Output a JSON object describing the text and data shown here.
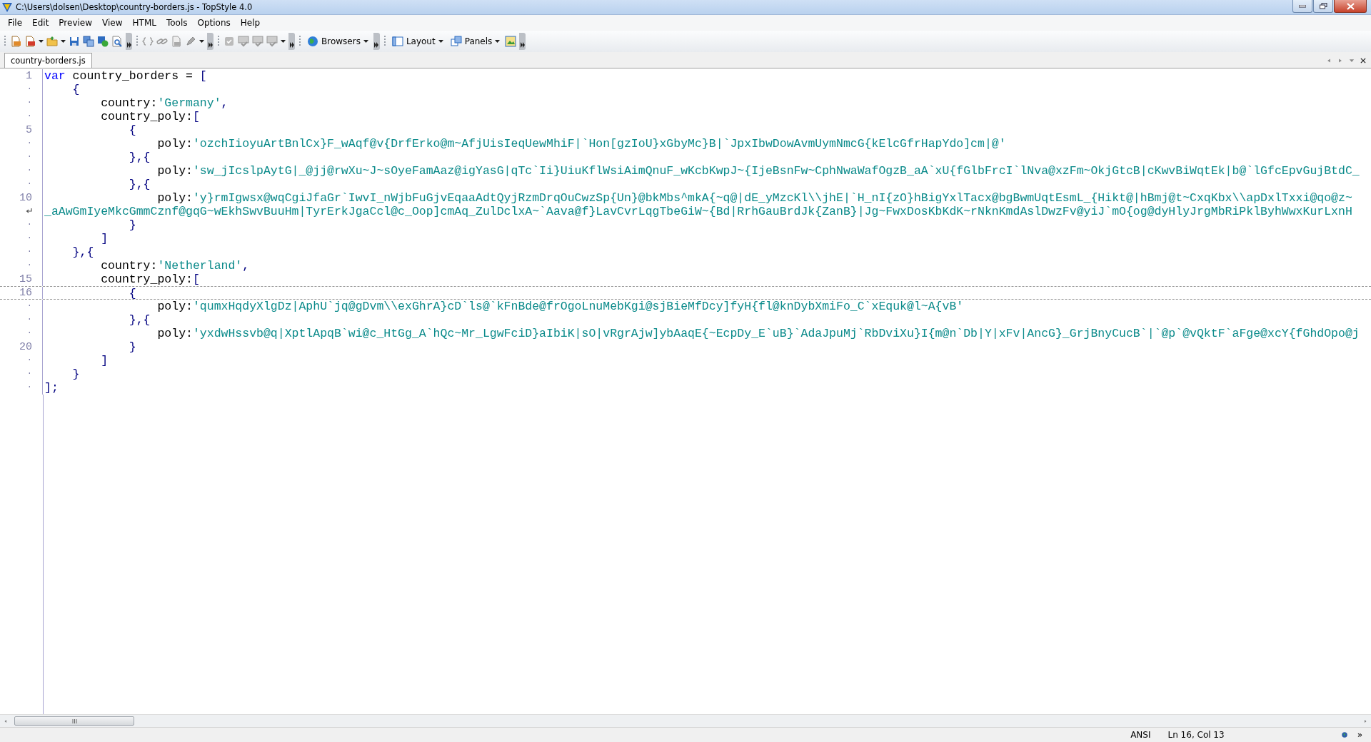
{
  "window": {
    "title": "C:\\Users\\dolsen\\Desktop\\country-borders.js - TopStyle 4.0"
  },
  "menu": [
    "File",
    "Edit",
    "Preview",
    "View",
    "HTML",
    "Tools",
    "Options",
    "Help"
  ],
  "toolbar": {
    "buttons": [
      "Browsers",
      "Layout",
      "Panels"
    ]
  },
  "tabs": [
    {
      "label": "country-borders.js",
      "selected": true
    }
  ],
  "editor": {
    "lines": [
      {
        "gutter": "1",
        "current": false,
        "segments": [
          {
            "kind": "keyword",
            "text": "var"
          },
          {
            "kind": "ident",
            "text": " country_borders = "
          },
          {
            "kind": "punct",
            "text": "["
          }
        ],
        "children": [
          {
            "gutter": "·",
            "current": false,
            "segments": [
              {
                "kind": "punct",
                "text": "{"
              }
            ],
            "children": [
              {
                "gutter": "·",
                "current": false,
                "segments": [
                  {
                    "kind": "ident",
                    "text": "country:"
                  },
                  {
                    "kind": "string",
                    "text": "'Germany'"
                  },
                  {
                    "kind": "punct",
                    "text": ","
                  }
                ]
              },
              {
                "gutter": "·",
                "current": false,
                "segments": [
                  {
                    "kind": "ident",
                    "text": "country_poly:"
                  },
                  {
                    "kind": "punct",
                    "text": "["
                  }
                ],
                "children": [
                  {
                    "gutter": "5",
                    "current": false,
                    "segments": [
                      {
                        "kind": "punct",
                        "text": "{"
                      }
                    ],
                    "children": [
                      {
                        "gutter": "·",
                        "current": false,
                        "segments": [
                          {
                            "kind": "ident",
                            "text": "poly:"
                          },
                          {
                            "kind": "string",
                            "text": "'ozchIioyuArtBnlCx}F_wAqf@v{DrfErko@m~AfjUisIeqUewMhiF|`Hon[gzIoU}xGbyMc}B|`JpxIbwDowAvmUymNmcG{kElcGfrHapYdo]cm|@'"
                          }
                        ]
                      }
                    ]
                  },
                  {
                    "gutter": "·",
                    "current": false,
                    "segments": [
                      {
                        "kind": "punct",
                        "text": "},{"
                      }
                    ],
                    "children": [
                      {
                        "gutter": "·",
                        "current": false,
                        "segments": [
                          {
                            "kind": "ident",
                            "text": "poly:"
                          },
                          {
                            "kind": "string",
                            "text": "'sw_jIcslpAytG|_@jj@rwXu~J~sOyeFamAaz@igYasG|qTc`Ii}UiuKflWsiAimQnuF_wKcbKwpJ~{IjeBsnFw~CphNwaWafOgzB_aA`xU{fGlbFrcI`lNva@xzFm~OkjGtcB|cKwvBiWqtEk|b@`lGfcEpvGujBtdC_"
                          }
                        ]
                      }
                    ]
                  },
                  {
                    "gutter": "·",
                    "current": false,
                    "segments": [
                      {
                        "kind": "punct",
                        "text": "},{"
                      }
                    ],
                    "children": [
                      {
                        "gutter": "10",
                        "current": false,
                        "segments": [
                          {
                            "kind": "ident",
                            "text": "poly:"
                          },
                          {
                            "kind": "string",
                            "text": "'y}rmIgwsx@wqCgiJfaGr`IwvI_nWjbFuGjvEqaaAdtQyjRzmDrqOuCwzSp{Un}@bkMbs^mkA{~q@|dE_yMzcKl\\\\jhE|`H_nI{zO}hBigYxlTacx@bgBwmUqtEsmL_{Hikt@|hBmj@t~CxqKbx\\\\apDxlTxxi@qo@z~"
                          }
                        ],
                        "continuation": "_aAwGmIyeMkcGmmCznf@gqG~wEkhSwvBuuHm|TyrErkJgaCcl@c_Oop]cmAq_ZulDclxA~`Aava@f}LavCvrLqgTbeGiW~{Bd|RrhGauBrdJk{ZanB}|Jg~FwxDosKbKdK~rNknKmdAslDwzFv@yiJ`mO{og@dyHlyJrgMbRiPklByhWwxKurLxnH"
                      }
                    ]
                  },
                  {
                    "gutter": "·",
                    "current": false,
                    "segments": [
                      {
                        "kind": "punct",
                        "text": "}"
                      }
                    ]
                  }
                ]
              },
              {
                "gutter": "·",
                "current": false,
                "segments": [
                  {
                    "kind": "punct",
                    "text": "]"
                  }
                ]
              }
            ]
          },
          {
            "gutter": "·",
            "current": false,
            "segments": [
              {
                "kind": "punct",
                "text": "},{"
              }
            ],
            "children": [
              {
                "gutter": "·",
                "current": false,
                "segments": [
                  {
                    "kind": "ident",
                    "text": "country:"
                  },
                  {
                    "kind": "string",
                    "text": "'Netherland'"
                  },
                  {
                    "kind": "punct",
                    "text": ","
                  }
                ]
              },
              {
                "gutter": "15",
                "current": false,
                "segments": [
                  {
                    "kind": "ident",
                    "text": "country_poly:"
                  },
                  {
                    "kind": "punct",
                    "text": "["
                  }
                ],
                "children": [
                  {
                    "gutter": "16",
                    "current": true,
                    "segments": [
                      {
                        "kind": "punct",
                        "text": "{"
                      }
                    ],
                    "children": [
                      {
                        "gutter": "·",
                        "current": false,
                        "segments": [
                          {
                            "kind": "ident",
                            "text": "poly:"
                          },
                          {
                            "kind": "string",
                            "text": "'qumxHqdyXlgDz|AphU`jq@gDvm\\\\exGhrA}cD`ls@`kFnBde@frOgoLnuMebKgi@sjBieMfDcy]fyH{fl@knDybXmiFo_C`xEquk@l~A{vB'"
                          }
                        ]
                      }
                    ]
                  },
                  {
                    "gutter": "·",
                    "current": false,
                    "segments": [
                      {
                        "kind": "punct",
                        "text": "},{"
                      }
                    ],
                    "children": [
                      {
                        "gutter": "·",
                        "current": false,
                        "segments": [
                          {
                            "kind": "ident",
                            "text": "poly:"
                          },
                          {
                            "kind": "string",
                            "text": "'yxdwHssvb@q|XptlApqB`wi@c_HtGg_A`hQc~Mr_LgwFciD}aIbiK|sO|vRgrAjw]ybAaqE{~EcpDy_E`uB}`AdaJpuMj`RbDviXu}I{m@n`Db|Y|xFv|AncG}_GrjBnyCucB`|`@p`@vQktF`aFge@xcY{fGhdOpo@j"
                          }
                        ]
                      }
                    ]
                  },
                  {
                    "gutter": "20",
                    "current": false,
                    "segments": [
                      {
                        "kind": "punct",
                        "text": "}"
                      }
                    ]
                  }
                ]
              },
              {
                "gutter": "·",
                "current": false,
                "segments": [
                  {
                    "kind": "punct",
                    "text": "]"
                  }
                ]
              }
            ]
          },
          {
            "gutter": "·",
            "current": false,
            "segments": [
              {
                "kind": "punct",
                "text": "}"
              }
            ]
          }
        ]
      },
      {
        "gutter": "·",
        "current": false,
        "segments": [
          {
            "kind": "punct",
            "text": "];"
          }
        ]
      }
    ]
  },
  "status_bar": {
    "encoding": "ANSI",
    "position": "Ln 16, Col 13",
    "more": "»"
  }
}
